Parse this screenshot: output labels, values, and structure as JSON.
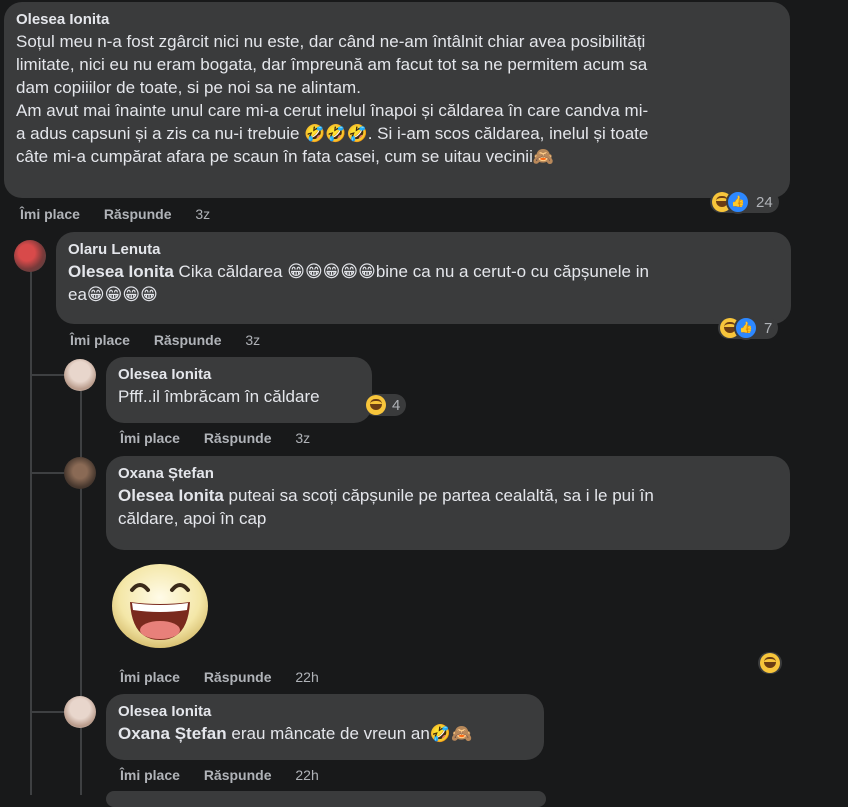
{
  "actions": {
    "like": "Îmi place",
    "reply": "Răspunde"
  },
  "comments": [
    {
      "author": "Olesea Ionita",
      "text": "Soțul meu n-a fost zgârcit nici nu este, dar când ne-am întâlnit chiar avea posibilități\nlimitate, nici eu nu eram bogata, dar împreună am facut tot sa ne permitem acum sa\ndam copiiilor de toate, si pe noi sa ne alintam.\nAm avut mai înainte unul care mi-a cerut inelul înapoi și căldarea în care candva mi-\na adus capsuni și a zis ca nu-i trebuie 🤣🤣🤣. Si i-am scos căldarea, inelul și toate\ncâte mi-a cumpărat afara pe scaun în fata casei, cum se uitau vecinii🙈",
      "time": "3z",
      "reactions": "24"
    },
    {
      "author": "Olaru Lenuta",
      "mention": "Olesea Ionita",
      "text": " Cika căldarea 😁😁😁😁😁bine ca nu a cerut-o cu căpșunele in\nea😁😁😁😁",
      "time": "3z",
      "reactions": "7"
    },
    {
      "author": "Olesea Ionita",
      "text": "Pfff..il îmbrăcam în căldare",
      "time": "3z",
      "reactions": "4"
    },
    {
      "author": "Oxana Ștefan",
      "mention": "Olesea Ionita",
      "text": " puteai sa scoți căpșunile pe partea cealaltă, sa i le pui în\ncăldare, apoi în cap",
      "time": "22h"
    },
    {
      "author": "Olesea Ionita",
      "mention": "Oxana Ștefan",
      "text": " erau mâncate de vreun an🤣🙈",
      "time": "22h"
    }
  ],
  "colors": {
    "background": "#18191a",
    "bubble": "#3a3b3c",
    "secondary_text": "#b0b3b8"
  }
}
